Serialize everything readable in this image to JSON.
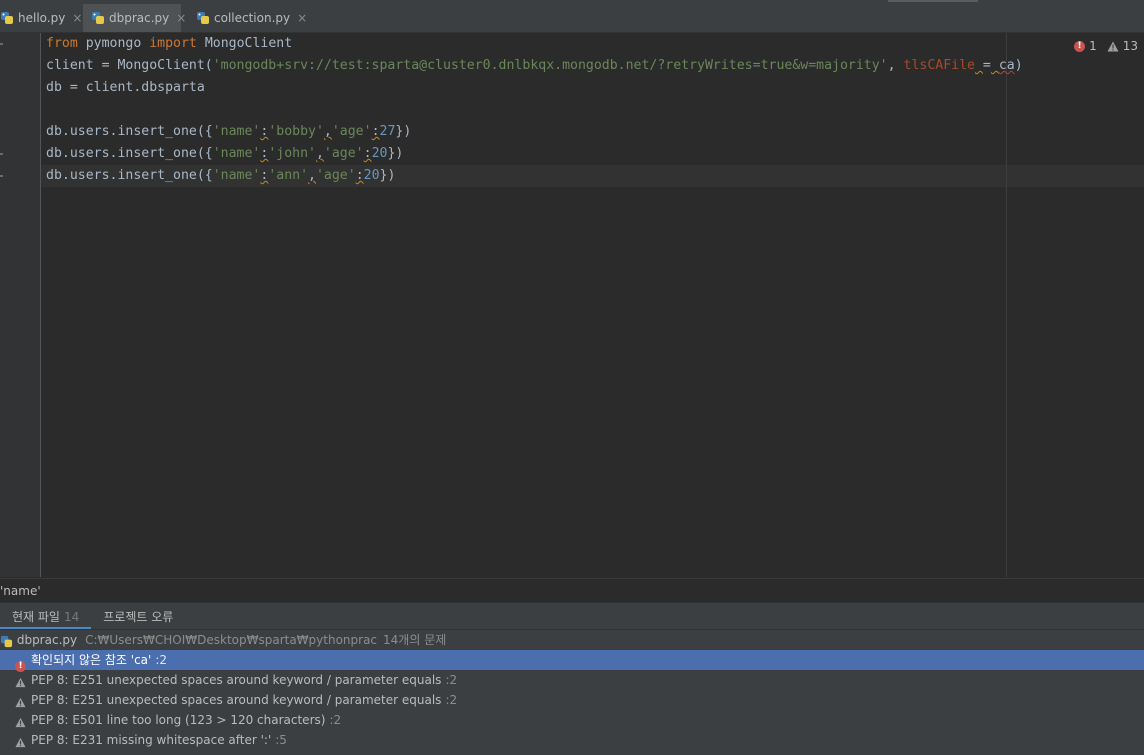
{
  "tabs": [
    {
      "label": "hello.py",
      "close": "×"
    },
    {
      "label": "dbprac.py",
      "close": "×",
      "active": true
    },
    {
      "label": "collection.py",
      "close": "×"
    }
  ],
  "indicators": {
    "errors": "1",
    "warnings": "13"
  },
  "breadcrumb": "'name'",
  "panel": {
    "tabs": [
      {
        "label": "현재 파일",
        "count": "14"
      },
      {
        "label": "프로젝트 오류"
      }
    ],
    "file": {
      "name": "dbprac.py",
      "path": "C:₩Users₩CHOI₩Desktop₩sparta₩pythonprac",
      "summary": "14개의 문제"
    },
    "problems": [
      {
        "severity": "error",
        "text": "확인되지 않은 참조 'ca'",
        "line": ":2"
      },
      {
        "severity": "warning",
        "text": "PEP 8: E251 unexpected spaces around keyword / parameter equals",
        "line": ":2"
      },
      {
        "severity": "warning",
        "text": "PEP 8: E251 unexpected spaces around keyword / parameter equals",
        "line": ":2"
      },
      {
        "severity": "warning",
        "text": "PEP 8: E501 line too long (123 > 120 characters)",
        "line": ":2"
      },
      {
        "severity": "warning",
        "text": "PEP 8: E231 missing whitespace after ':'",
        "line": ":5"
      }
    ]
  },
  "code": {
    "l1": {
      "kw1": "from",
      "mod": " pymongo ",
      "kw2": "import",
      "name": " MongoClient"
    },
    "l2": {
      "pre": "client = MongoClient(",
      "str": "'mongodb+srv://test:sparta@cluster0.dnlbkqx.mongodb.net/?retryWrites=true&w=majority'",
      "comma": ", ",
      "param": "tlsCAFile",
      "sp1": " ",
      "eq": "=",
      "sp2": " ",
      "ca": "ca",
      "close": ")"
    },
    "l3": {
      "text": "db = client.dbsparta"
    },
    "l5": {
      "pre": "db.users.insert_one({",
      "k1": "'name'",
      "c1": ":",
      "v1": "'bobby'",
      "sep": ",",
      "k2": "'age'",
      "c2": ":",
      "v2": "27",
      "close": "})"
    },
    "l6": {
      "pre": "db.users.insert_one({",
      "k1": "'name'",
      "c1": ":",
      "v1": "'john'",
      "sep": ",",
      "k2": "'age'",
      "c2": ":",
      "v2": "20",
      "close": "})"
    },
    "l7": {
      "pre": "db.users.insert_one({",
      "k1": "'name'",
      "c1": ":",
      "v1": "'ann'",
      "sep": ",",
      "k2": "'age'",
      "c2": ":",
      "v2": "20",
      "close": "})"
    }
  },
  "colors": {
    "keyword": "#cc7832",
    "string": "#6a8759",
    "number": "#6897bb",
    "selection": "#4b6eaf"
  }
}
